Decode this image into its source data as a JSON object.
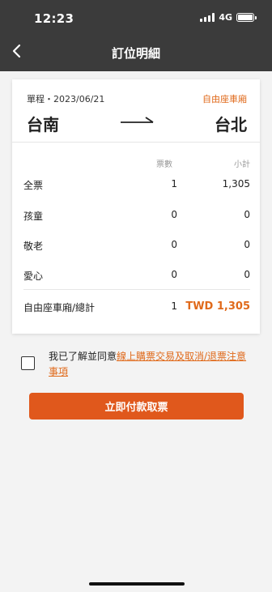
{
  "status_bar": {
    "time": "12:23",
    "network": "4G"
  },
  "header": {
    "title": "訂位明細"
  },
  "trip": {
    "meta": "單程・2023/06/21",
    "car_type": "自由座車廂",
    "from": "台南",
    "to": "台北"
  },
  "table": {
    "col_count": "票數",
    "col_subtotal": "小計",
    "rows": [
      {
        "label": "全票",
        "count": "1",
        "subtotal": "1,305"
      },
      {
        "label": "孩童",
        "count": "0",
        "subtotal": "0"
      },
      {
        "label": "敬老",
        "count": "0",
        "subtotal": "0"
      },
      {
        "label": "愛心",
        "count": "0",
        "subtotal": "0"
      }
    ],
    "total": {
      "label": "自由座車廂/總計",
      "count": "1",
      "subtotal": "TWD 1,305"
    }
  },
  "agreement": {
    "prefix": "我已了解並同意",
    "link": "線上購票交易及取消/退票注意事項",
    "checked": false
  },
  "pay_button": {
    "label": "立即付款取票"
  },
  "colors": {
    "accent": "#e06a1b",
    "header": "#3b3b3b",
    "button": "#e0581c"
  }
}
